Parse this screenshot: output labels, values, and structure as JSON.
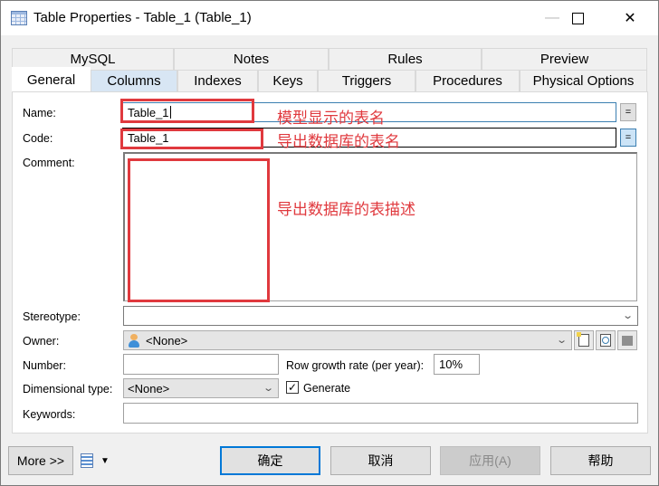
{
  "window": {
    "title": "Table Properties - Table_1 (Table_1)",
    "icon": "table-grid-icon",
    "controls": {
      "minimize": "—",
      "maximize": "maximize-icon",
      "close": "✕"
    }
  },
  "tabs": {
    "row1": [
      {
        "label": "MySQL"
      },
      {
        "label": "Notes"
      },
      {
        "label": "Rules"
      },
      {
        "label": "Preview"
      }
    ],
    "row2": [
      {
        "label": "General",
        "active": true
      },
      {
        "label": "Columns",
        "hover": true
      },
      {
        "label": "Indexes"
      },
      {
        "label": "Keys"
      },
      {
        "label": "Triggers"
      },
      {
        "label": "Procedures"
      },
      {
        "label": "Physical Options"
      }
    ]
  },
  "form": {
    "name_label": "Name:",
    "name_value": "Table_1",
    "code_label": "Code:",
    "code_value": "Table_1",
    "equals_label": "=",
    "comment_label": "Comment:",
    "comment_value": "",
    "stereotype_label": "Stereotype:",
    "stereotype_value": "",
    "owner_label": "Owner:",
    "owner_value": "<None>",
    "number_label": "Number:",
    "number_value": "",
    "row_growth_label": "Row growth rate (per year):",
    "row_growth_value": "10%",
    "dimensional_label": "Dimensional type:",
    "dimensional_value": "<None>",
    "generate_label": "Generate",
    "generate_checked": true,
    "keywords_label": "Keywords:",
    "keywords_value": ""
  },
  "annotations": {
    "name_note": "模型显示的表名",
    "code_note": "导出数据库的表名",
    "comment_note": "导出数据库的表描述",
    "color": "#e0393e"
  },
  "footer": {
    "more_label": "More >>",
    "ok_label": "确定",
    "cancel_label": "取消",
    "apply_label": "应用(A)",
    "help_label": "帮助"
  }
}
